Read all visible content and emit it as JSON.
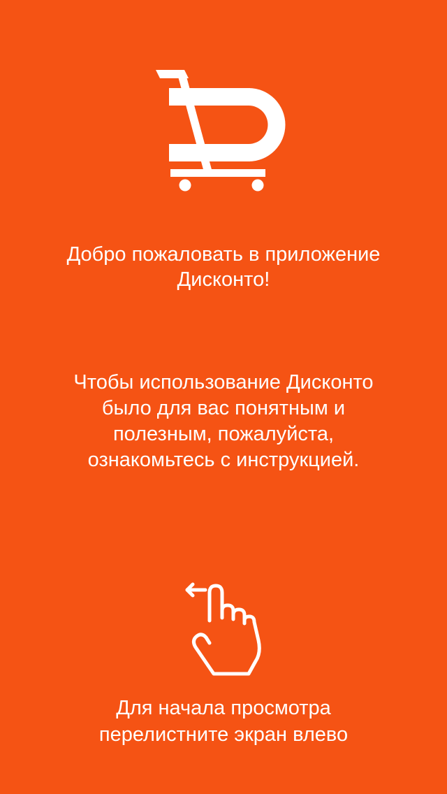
{
  "theme": {
    "background": "#f55314",
    "foreground": "#ffffff"
  },
  "logo": {
    "icon": "cart-d-logo-icon"
  },
  "welcome": {
    "line1": "Добро пожаловать в приложение",
    "line2": "Дисконто!"
  },
  "instructions": {
    "lines": [
      "Чтобы использование Дисконто",
      "было для вас понятным и",
      "полезным, пожалуйста,",
      "ознакомьтесь с инструкцией."
    ]
  },
  "swipe_hint": {
    "icon": "swipe-left-hand-icon",
    "line1": "Для начала просмотра",
    "line2": "перелистните экран влево"
  }
}
